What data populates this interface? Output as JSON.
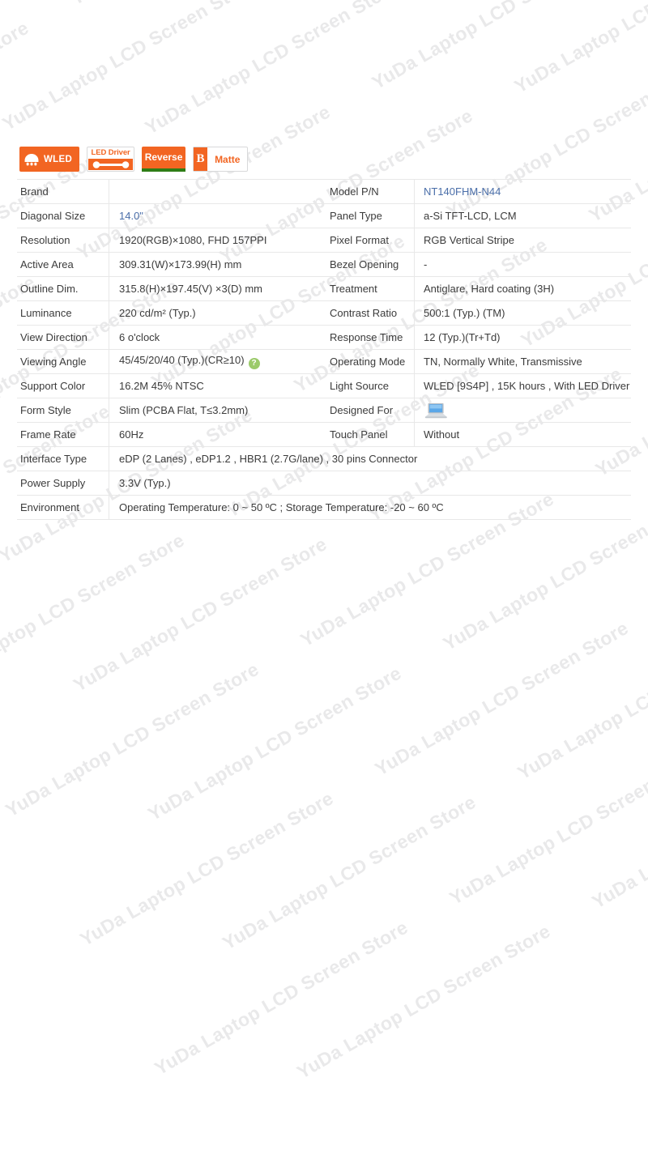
{
  "watermark": {
    "text": "YuDa Laptop LCD Screen Store",
    "color": "#e9e9ea",
    "angle_deg": -30
  },
  "badges": [
    {
      "id": "wled",
      "label": "WLED",
      "icon": "wled-lamp-icon",
      "bg": "#f26522",
      "text_color": "#ffffff"
    },
    {
      "id": "led-driver",
      "label": "LED Driver",
      "icon": "led-driver-cable-icon",
      "bg": "#ffffff",
      "text_color": "#f26522"
    },
    {
      "id": "reverse",
      "label": "Reverse",
      "icon": "reverse-bar-icon",
      "bg": "#f26522",
      "text_color": "#ffffff",
      "accent": "#2e7d16"
    },
    {
      "id": "matte",
      "label": "Matte",
      "icon": "matte-b-icon",
      "glyph": "B",
      "bg": "#ffffff",
      "text_color": "#f26522"
    }
  ],
  "spec_table": {
    "accent_link_color": "#4a6ea9",
    "rows": [
      {
        "left_label": "Brand",
        "left_value": "",
        "right_label": "Model P/N",
        "right_value": "NT140FHM-N44",
        "right_link": true
      },
      {
        "left_label": "Diagonal Size",
        "left_value": "14.0\"",
        "left_link": true,
        "right_label": "Panel Type",
        "right_value": "a-Si TFT-LCD, LCM"
      },
      {
        "left_label": "Resolution",
        "left_value": "1920(RGB)×1080, FHD  157PPI",
        "right_label": "Pixel Format",
        "right_value": "RGB Vertical Stripe"
      },
      {
        "left_label": "Active Area",
        "left_value": "309.31(W)×173.99(H) mm",
        "right_label": "Bezel Opening",
        "right_value": "-"
      },
      {
        "left_label": "Outline Dim.",
        "left_value": "315.8(H)×197.45(V) ×3(D) mm",
        "right_label": "Treatment",
        "right_value": "Antiglare, Hard coating (3H)"
      },
      {
        "left_label": "Luminance",
        "left_value": "220 cd/m² (Typ.)",
        "right_label": "Contrast Ratio",
        "right_value": "500:1 (Typ.) (TM)"
      },
      {
        "left_label": "View Direction",
        "left_value": "6 o'clock",
        "right_label": "Response Time",
        "right_value": "12 (Typ.)(Tr+Td)"
      },
      {
        "left_label": "Viewing Angle",
        "left_value": "45/45/20/40 (Typ.)(CR≥10)",
        "left_help_icon": "?",
        "right_label": "Operating Mode",
        "right_value": "TN, Normally White, Transmissive"
      },
      {
        "left_label": "Support Color",
        "left_value": "16.2M  45% NTSC",
        "right_label": "Light Source",
        "right_value": "WLED  [9S4P] , 15K hours , With LED Driver"
      },
      {
        "left_label": "Form Style",
        "left_value": "Slim (PCBA Flat, T≤3.2mm)",
        "right_label": "Designed For",
        "right_value": "",
        "right_icon": "laptop-icon"
      },
      {
        "left_label": "Frame Rate",
        "left_value": "60Hz",
        "right_label": "Touch Panel",
        "right_value": "Without"
      }
    ],
    "wide_rows": [
      {
        "label": "Interface Type",
        "value": "eDP (2 Lanes) , eDP1.2 , HBR1 (2.7G/lane) , 30 pins Connector"
      },
      {
        "label": "Power Supply",
        "value": "3.3V (Typ.)"
      },
      {
        "label": "Environment",
        "value": "Operating Temperature: 0 ~ 50 ºC ; Storage Temperature: -20 ~ 60 ºC"
      }
    ]
  }
}
